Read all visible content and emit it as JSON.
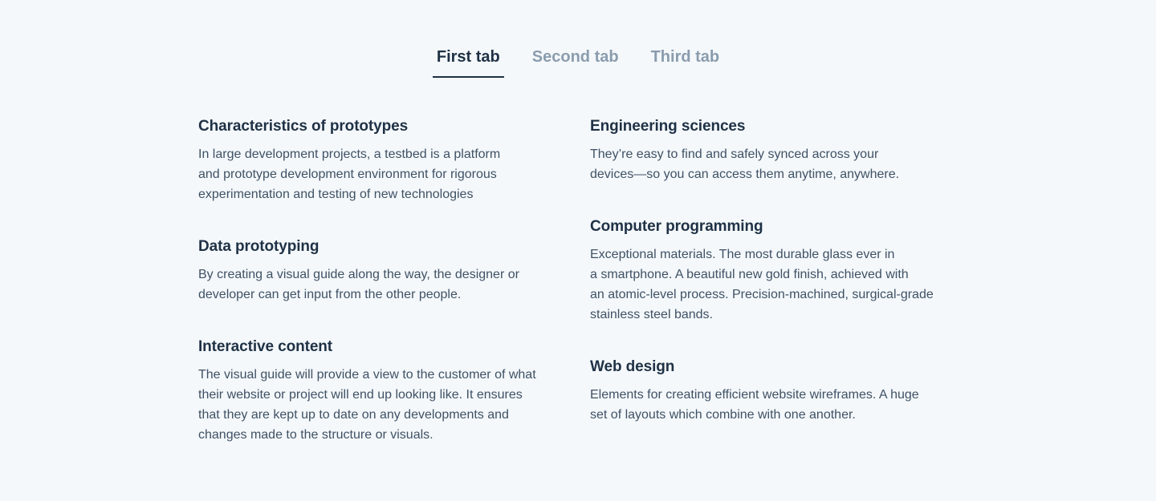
{
  "tabs": [
    {
      "label": "First tab",
      "active": true
    },
    {
      "label": "Second tab",
      "active": false
    },
    {
      "label": "Third tab",
      "active": false
    }
  ],
  "left_column": [
    {
      "title": "Characteristics of prototypes",
      "text": "In large development projects, a testbed is a platform\nand prototype development environment for rigorous\nexperimentation and testing of new technologies"
    },
    {
      "title": "Data prototyping",
      "text": "By creating a visual guide along the way, the designer or\ndeveloper can get input from the other people."
    },
    {
      "title": "Interactive content",
      "text": "The visual guide will provide a view to the customer of what\ntheir website or project will end up looking like. It ensures\nthat they are kept up to date on any developments and\nchanges made to the structure or visuals."
    }
  ],
  "right_column": [
    {
      "title": "Engineering sciences",
      "text": "They’re easy to find and safely synced across your\ndevices—so you can access them anytime, anywhere."
    },
    {
      "title": "Computer programming",
      "text": "Exceptional materials. The most durable glass ever in\na smartphone. A beautiful new gold finish, achieved with\nan atomic-level process. Precision-machined, surgical-grade\nstainless steel bands."
    },
    {
      "title": "Web design",
      "text": "Elements for creating efficient website wireframes. A huge\nset of layouts which combine with one another."
    }
  ]
}
